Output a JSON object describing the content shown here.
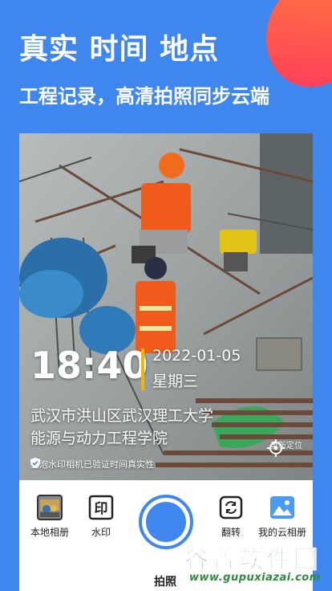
{
  "promo": {
    "headline": "真实 时间 地点",
    "subline": "工程记录，高清拍照同步云端"
  },
  "watermark": {
    "time": "18:40",
    "date": "2022-01-05",
    "weekday": "星期三",
    "address_line1": "武汉市洪山区武汉理工大学",
    "address_line2": "能源与动力工程学院",
    "verify_text": "鱼泡水印相机已验证时间真实性",
    "relocate_label": "重新定位"
  },
  "toolbar": {
    "local_album": "本地相册",
    "watermark": "水印",
    "flip": "翻转",
    "cloud_album": "我的云相册",
    "capture": "拍照"
  },
  "site": {
    "logo_text": "谷普软件园",
    "url": "www.gupuxiazai.com"
  },
  "colors": {
    "brand_blue": "#3f86ef",
    "accent_yellow": "#f5b400"
  }
}
